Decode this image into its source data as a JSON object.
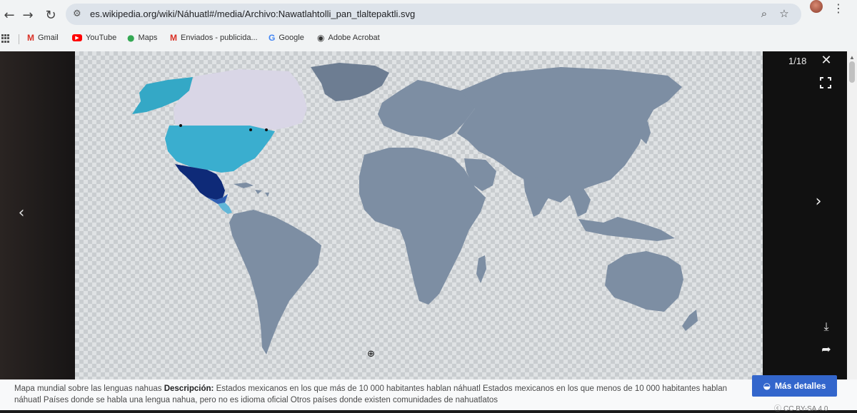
{
  "browser": {
    "url": "es.wikipedia.org/wiki/Náhuatl#/media/Archivo:Nawatlahtolli_pan_tlaltepaktli.svg",
    "back_icon": "arrow-left-icon",
    "forward_icon": "arrow-right-icon",
    "reload_icon": "reload-icon",
    "bookmarks": [
      {
        "label": "Gmail",
        "icon": "gmail-icon",
        "color": "#d93025"
      },
      {
        "label": "YouTube",
        "icon": "youtube-icon",
        "color": "#ff0000"
      },
      {
        "label": "Maps",
        "icon": "maps-pin-icon",
        "color": "#34a853"
      },
      {
        "label": "Enviados - publicida...",
        "icon": "gmail-icon",
        "color": "#d93025"
      },
      {
        "label": "Google",
        "icon": "google-icon",
        "color": "#4285f4"
      },
      {
        "label": "Adobe Acrobat",
        "icon": "acrobat-icon",
        "color": "#333333"
      }
    ]
  },
  "viewer": {
    "counter": "1/18",
    "caption_title": "Mapa mundial sobre las lenguas nahuas",
    "description_label": "Descripción:",
    "description": "Estados mexicanos en los que más de 10 000 habitantes hablan náhuatl   Estados mexicanos en los que menos de 10 000 habitantes hablan náhuatl   Países donde se habla una lengua nahua, pero no es idioma oficial   Otros países donde existen comunidades de nahuatlatos",
    "more_details_label": "Más detalles",
    "license": "CC BY-SA 4.0"
  },
  "map_colors": {
    "land_default": "#7d8ea3",
    "mexico_dark": "#0e2a78",
    "mexico_light": "#2f5fb3",
    "us_teal": "#3aaecf",
    "alaska": "#34a8c6",
    "canada": "#d9d6e6",
    "greenland": "#6d7d92",
    "central_america": "#62b7d8",
    "caption_button": "#3366cc"
  }
}
